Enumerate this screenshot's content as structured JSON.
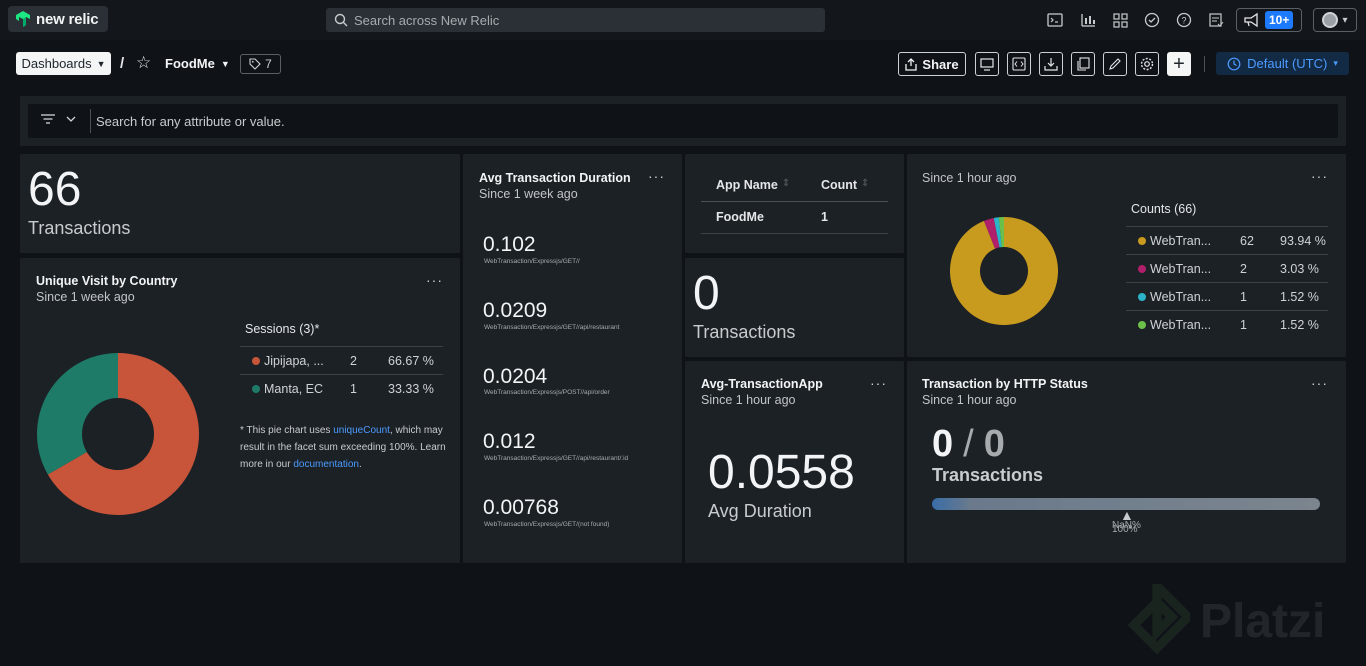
{
  "topbar": {
    "logo_text": "new relic",
    "search_placeholder": "Search across New Relic",
    "notification_count": "10+"
  },
  "header": {
    "dashboards_label": "Dashboards",
    "separator": "/",
    "dashboard_name": "FoodMe",
    "tag_count": "7",
    "share_label": "Share",
    "timezone_label": "Default (UTC)"
  },
  "filter": {
    "placeholder": "Search for any attribute or value."
  },
  "widgets": {
    "transactions_top": {
      "value": "66",
      "label": "Transactions"
    },
    "unique_visit": {
      "title": "Unique Visit by Country",
      "subtitle": "Since 1 week ago",
      "legend_title": "Sessions (3)*",
      "rows": [
        {
          "name": "Jipijapa, ...",
          "count": "2",
          "pct": "66.67 %",
          "color": "#c8553a"
        },
        {
          "name": "Manta, EC",
          "count": "1",
          "pct": "33.33 %",
          "color": "#1e7b68"
        }
      ],
      "note_prefix": "* This pie chart uses ",
      "note_link1": "uniqueCount",
      "note_mid": ", which may result in the facet sum exceeding 100%. Learn more in our ",
      "note_link2": "documentation",
      "note_suffix": "."
    },
    "avg_duration": {
      "title": "Avg Transaction Duration",
      "subtitle": "Since 1 week ago",
      "items": [
        {
          "value": "0.102",
          "name": "WebTransaction/Expressjs/GET//"
        },
        {
          "value": "0.0209",
          "name": "WebTransaction/Expressjs/GET//api/restaurant"
        },
        {
          "value": "0.0204",
          "name": "WebTransaction/Expressjs/POST//api/order"
        },
        {
          "value": "0.012",
          "name": "WebTransaction/Expressjs/GET//api/restaurant/:id"
        },
        {
          "value": "0.00768",
          "name": "WebTransaction/Expressjs/GET/(not found)"
        }
      ]
    },
    "app_table": {
      "columns": [
        "App Name",
        "Count"
      ],
      "rows": [
        [
          "FoodMe",
          "1"
        ]
      ]
    },
    "transactions_zero": {
      "value": "0",
      "label": "Transactions"
    },
    "counts_pie": {
      "subtitle": "Since 1 hour ago",
      "legend_title": "Counts (66)",
      "rows": [
        {
          "name": "WebTran...",
          "count": "62",
          "pct": "93.94 %",
          "color": "#c89a1e"
        },
        {
          "name": "WebTran...",
          "count": "2",
          "pct": "3.03 %",
          "color": "#b0206a"
        },
        {
          "name": "WebTran...",
          "count": "1",
          "pct": "1.52 %",
          "color": "#2bb3c9"
        },
        {
          "name": "WebTran...",
          "count": "1",
          "pct": "1.52 %",
          "color": "#6cc04a"
        }
      ]
    },
    "avg_app": {
      "title": "Avg-TransactionApp",
      "subtitle": "Since 1 hour ago",
      "value": "0.0558",
      "label": "Avg Duration"
    },
    "http_status": {
      "title": "Transaction by HTTP Status",
      "subtitle": "Since 1 hour ago",
      "value_a": "0",
      "sep": "/",
      "value_b": "0",
      "label": "Transactions",
      "marker_label_a": "NaN%",
      "marker_label_b": "100%",
      "fill_fraction": 0.0
    }
  },
  "chart_data": [
    {
      "type": "pie",
      "title": "Unique Visit by Country",
      "categories": [
        "Jipijapa, ...",
        "Manta, EC"
      ],
      "values": [
        2,
        1
      ],
      "percent": [
        66.67,
        33.33
      ]
    },
    {
      "type": "pie",
      "title": "Counts (66)",
      "categories": [
        "WebTran...",
        "WebTran...",
        "WebTran...",
        "WebTran..."
      ],
      "values": [
        62,
        2,
        1,
        1
      ],
      "percent": [
        93.94,
        3.03,
        1.52,
        1.52
      ]
    }
  ]
}
